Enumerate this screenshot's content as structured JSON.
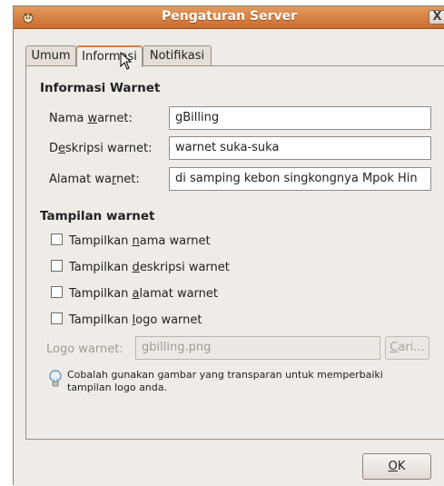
{
  "window": {
    "title": "Pengaturan Server",
    "close_glyph": "X"
  },
  "tabs": [
    {
      "label": "Umum",
      "active": false
    },
    {
      "label": "Informasi",
      "active": true
    },
    {
      "label": "Notifikasi",
      "active": false
    }
  ],
  "info_section": {
    "title": "Informasi Warnet",
    "name_label_pre": "Nama ",
    "name_label_u": "w",
    "name_label_post": "arnet:",
    "name_value": "gBilling",
    "desc_label_pre": "D",
    "desc_label_u": "e",
    "desc_label_post": "skripsi warnet:",
    "desc_value": "warnet suka-suka",
    "addr_label_pre": "Alamat wa",
    "addr_label_u": "r",
    "addr_label_post": "net:",
    "addr_value": "di samping kebon singkongnya Mpok Hin"
  },
  "display_section": {
    "title": "Tampilan warnet",
    "checks": [
      {
        "pre": "Tampilkan ",
        "u": "n",
        "post": "ama warnet",
        "checked": false
      },
      {
        "pre": "Tampilkan ",
        "u": "d",
        "post": "eskripsi warnet",
        "checked": false
      },
      {
        "pre": "Tampilkan ",
        "u": "a",
        "post": "lamat warnet",
        "checked": false
      },
      {
        "pre": "Tampilkan ",
        "u": "l",
        "post": "ogo warnet",
        "checked": false
      }
    ],
    "logo_label": "Logo warnet:",
    "logo_value": "gbilling.png",
    "browse_u": "C",
    "browse_post": "ari...",
    "hint_line1": "Cobalah gunakan gambar yang transparan untuk memperbaiki",
    "hint_line2": "tampilan logo anda."
  },
  "ok_u": "O",
  "ok_post": "K",
  "colors": {
    "title_bar": "#d07a3c",
    "accent": "#e07b38",
    "window_bg": "#efebe7"
  },
  "icons": [
    "app-icon",
    "close-icon",
    "lightbulb-icon",
    "mouse-pointer-icon"
  ]
}
